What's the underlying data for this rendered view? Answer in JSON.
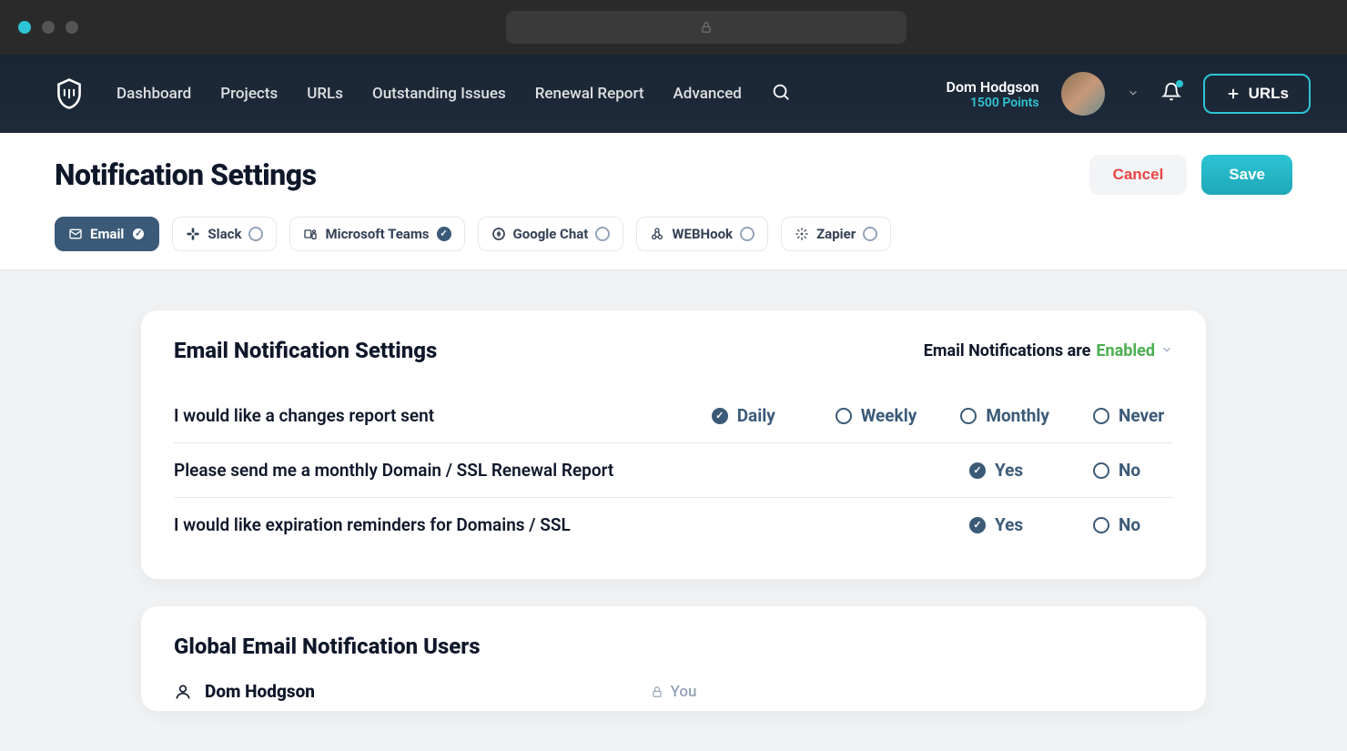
{
  "nav": {
    "items": [
      "Dashboard",
      "Projects",
      "URLs",
      "Outstanding Issues",
      "Renewal Report",
      "Advanced"
    ],
    "user": {
      "name": "Dom Hodgson",
      "points": "1500 Points"
    },
    "urls_button": "URLs"
  },
  "page": {
    "title": "Notification Settings",
    "cancel": "Cancel",
    "save": "Save"
  },
  "channels": [
    {
      "label": "Email",
      "active": true,
      "checked": true
    },
    {
      "label": "Slack",
      "active": false,
      "checked": false
    },
    {
      "label": "Microsoft Teams",
      "active": false,
      "checked": true
    },
    {
      "label": "Google Chat",
      "active": false,
      "checked": false
    },
    {
      "label": "WEBHook",
      "active": false,
      "checked": false
    },
    {
      "label": "Zapier",
      "active": false,
      "checked": false
    }
  ],
  "email_card": {
    "title": "Email Notification Settings",
    "status_prefix": "Email Notifications are ",
    "status_value": "Enabled",
    "settings": [
      {
        "label": "I would like a changes report sent",
        "options": [
          "Daily",
          "Weekly",
          "Monthly",
          "Never"
        ],
        "selected": "Daily"
      },
      {
        "label": "Please send me a monthly Domain / SSL Renewal Report",
        "options": [
          "Yes",
          "No"
        ],
        "selected": "Yes"
      },
      {
        "label": "I would like expiration reminders for Domains / SSL",
        "options": [
          "Yes",
          "No"
        ],
        "selected": "Yes"
      }
    ]
  },
  "users_card": {
    "title": "Global Email Notification Users",
    "users": [
      {
        "name": "Dom Hodgson",
        "tag": "You"
      }
    ]
  }
}
